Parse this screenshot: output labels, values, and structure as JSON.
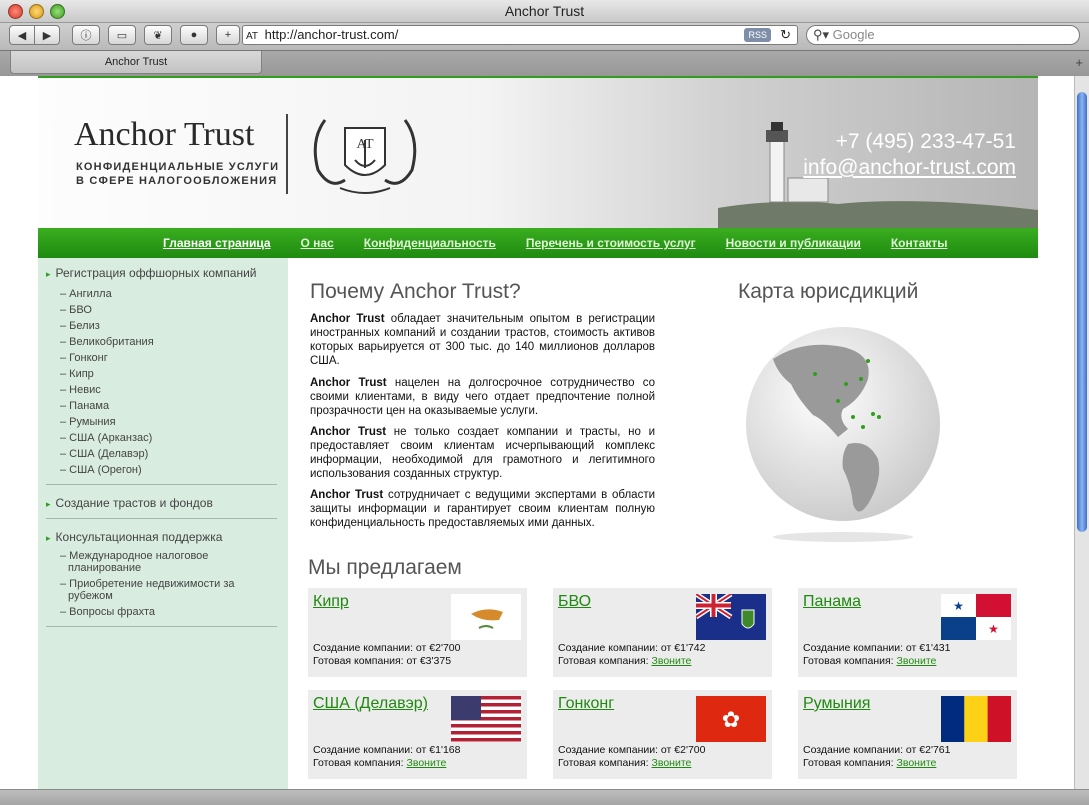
{
  "window": {
    "title": "Anchor Trust"
  },
  "toolbar": {
    "url_prefix": "AT",
    "url": "http://anchor-trust.com/",
    "rss_label": "RSS",
    "search_placeholder": "Google"
  },
  "tab": {
    "label": "Anchor Trust"
  },
  "header": {
    "logo_name": "Anchor Trust",
    "tagline_1": "КОНФИДЕНЦИАЛЬНЫЕ УСЛУГИ",
    "tagline_2": "В СФЕРЕ НАЛОГООБЛОЖЕНИЯ",
    "crest_text": "AT",
    "phone": "+7 (495) 233-47-51",
    "email": "info@anchor-trust.com"
  },
  "nav": [
    {
      "label": "Главная страница"
    },
    {
      "label": "О нас"
    },
    {
      "label": "Конфиденциальность"
    },
    {
      "label": "Перечень и стоимость услуг"
    },
    {
      "label": "Новости и публикации"
    },
    {
      "label": "Контакты"
    }
  ],
  "sidebar": {
    "section1": "Регистрация оффшорных компаний",
    "items1": [
      "– Ангилла",
      "– БВО",
      "– Белиз",
      "– Великобритания",
      "– Гонконг",
      "– Кипр",
      "– Невис",
      "– Панама",
      "– Румыния",
      "– США (Арканзас)",
      "– США (Делавэр)",
      "– США (Орегон)"
    ],
    "section2": "Создание трастов и фондов",
    "section3": "Консультационная поддержка",
    "items3": [
      "– Международное налоговое",
      "планирование",
      "– Приобретение недвижимости за",
      "рубежом",
      "– Вопросы фрахта"
    ]
  },
  "main": {
    "title": "Почему Anchor Trust?",
    "brand": "Anchor Trust",
    "p1": " обладает значительным опытом в регистрации иностранных компаний и создании трастов, стоимость активов которых варьируется от 300 тыс. до 140 миллионов долларов США.",
    "p2": " нацелен на долгосрочное сотрудничество со своими клиентами, в виду чего отдает предпочтение полной прозрачности цен на оказываемые услуги.",
    "p3": " не только создает компании и трасты, но и предоставляет своим клиентам исчерпывающий комплекс информации, необходимой для грамотного и легитимного использования созданных структур.",
    "p4": " сотрудничает с ведущими экспертами в области защиты информации и гарантирует своим клиентам полную конфиденциальность предоставляемых ими данных.",
    "map_title": "Карта юрисдикций",
    "offer_title": "Мы предлагаем"
  },
  "offers": [
    {
      "name": "Кипр",
      "line1": "Создание компании: от €2'700",
      "line2_label": "Готовая компания: от €3'375",
      "line2_link": ""
    },
    {
      "name": "БВО",
      "line1": "Создание компании: от €1'742",
      "line2_label": "Готовая компания: ",
      "line2_link": "Звоните"
    },
    {
      "name": "Панама",
      "line1": "Создание компании: от €1'431",
      "line2_label": "Готовая компания: ",
      "line2_link": "Звоните"
    },
    {
      "name": "США (Делавэр)",
      "line1": "Создание компании: от €1'168",
      "line2_label": "Готовая компания: ",
      "line2_link": "Звоните"
    },
    {
      "name": "Гонконг",
      "line1": "Создание компании: от €2'700",
      "line2_label": "Готовая компания: ",
      "line2_link": "Звоните"
    },
    {
      "name": "Румыния",
      "line1": "Создание компании: от €2'761",
      "line2_label": "Готовая компания: ",
      "line2_link": "Звоните"
    }
  ],
  "colors": {
    "brand_green": "#2f9e1c",
    "sidebar_bg": "#d9ece0",
    "link_green": "#1f8a10"
  }
}
